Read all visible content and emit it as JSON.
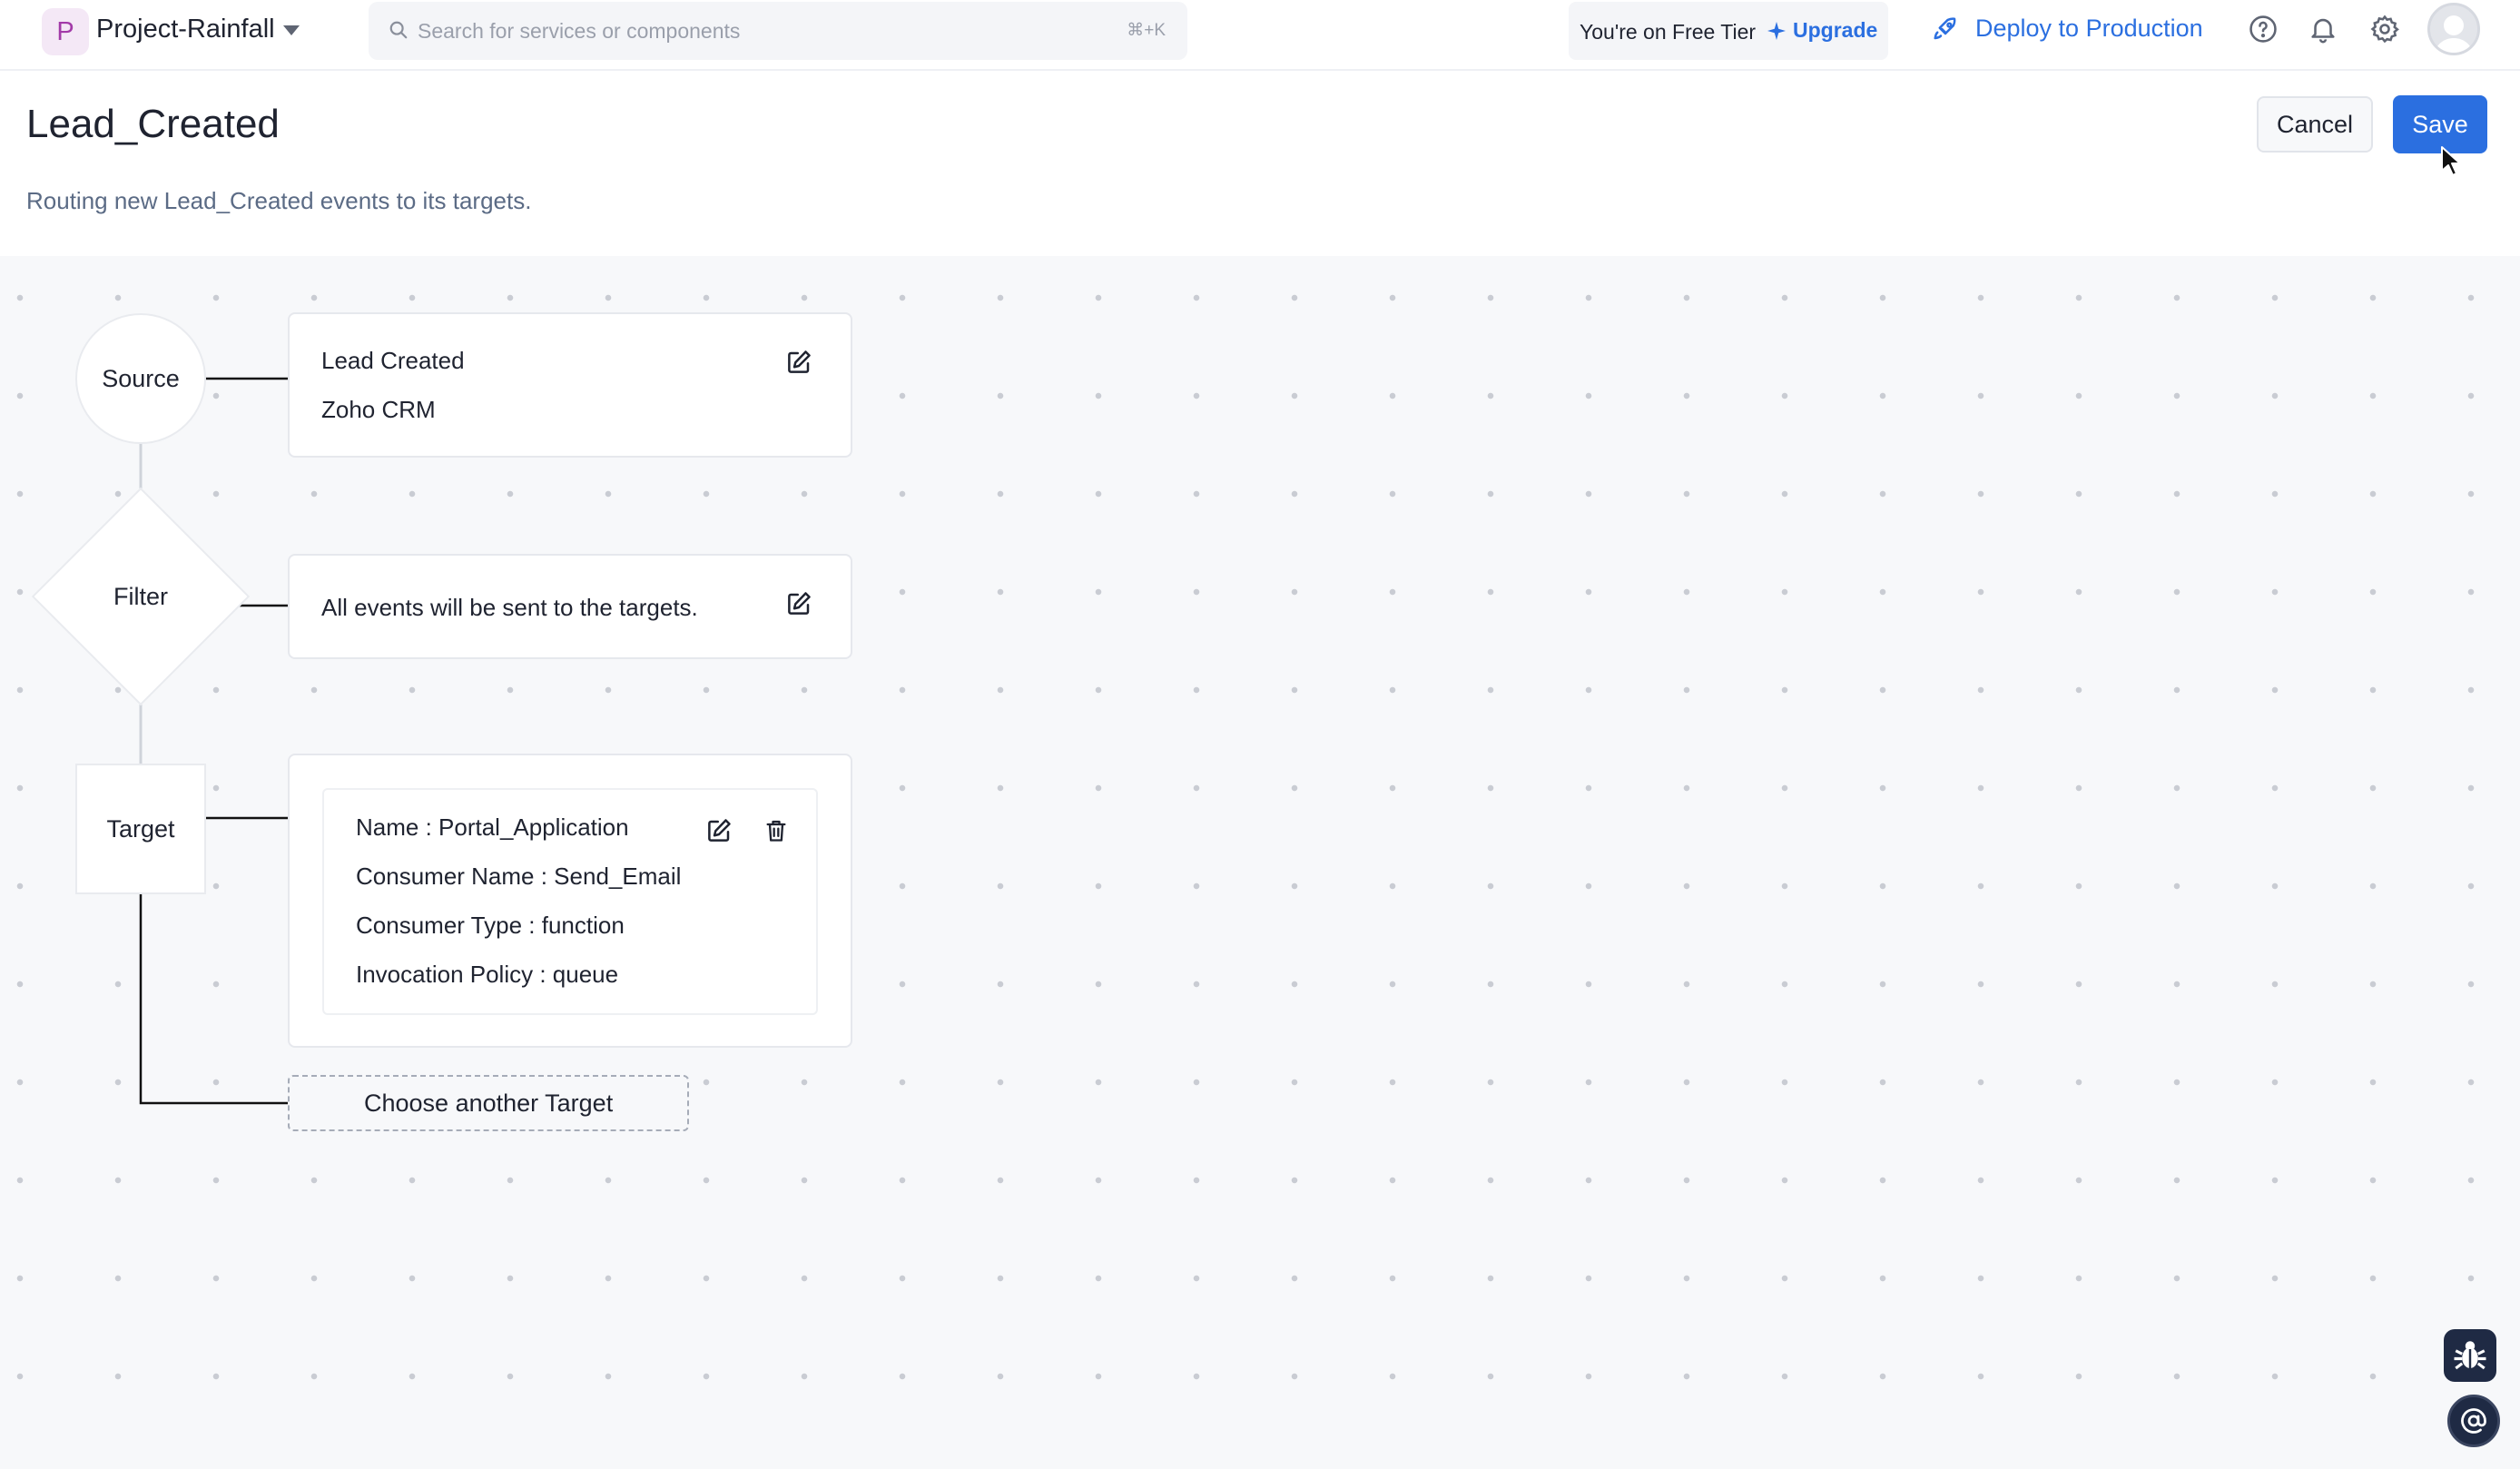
{
  "app": {
    "project_initial": "P",
    "project_name": "Project-Rainfall",
    "project_icon": "chevron-down-icon"
  },
  "search": {
    "placeholder": "Search for services or components",
    "value": "",
    "shortcut": "⌘+K"
  },
  "tier": {
    "text": "You're on Free Tier",
    "upgrade_label": "Upgrade"
  },
  "deploy": {
    "label": "Deploy to Production"
  },
  "header": {
    "title": "Lead_Created",
    "description": "Routing new Lead_Created events to its targets.",
    "cancel_label": "Cancel",
    "save_label": "Save"
  },
  "flow": {
    "source": {
      "node_label": "Source",
      "event": "Lead Created",
      "service": "Zoho CRM"
    },
    "filter": {
      "node_label": "Filter",
      "text": "All events will be sent to the targets."
    },
    "target": {
      "node_label": "Target",
      "items": [
        {
          "name": "Name : Portal_Application",
          "consumer_name": "Consumer Name : Send_Email",
          "consumer_type": "Consumer Type : function",
          "invocation_policy": "Invocation Policy : queue"
        }
      ],
      "choose_another_label": "Choose another Target"
    }
  },
  "colors": {
    "accent": "#2b6fe0",
    "canvas_bg": "#f7f8fa",
    "fab_bg": "#1f2a44"
  }
}
